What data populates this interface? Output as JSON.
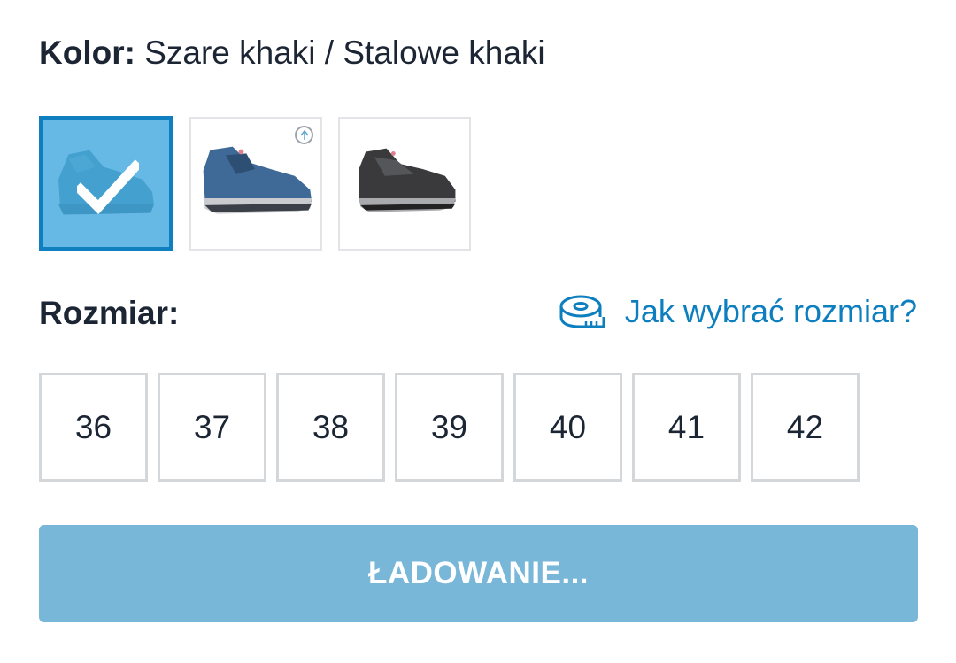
{
  "color": {
    "label": "Kolor:",
    "value": "Szare khaki / Stalowe khaki",
    "swatches": [
      {
        "name": "grey-khaki-shoe",
        "selected": true
      },
      {
        "name": "blue-shoe",
        "selected": false,
        "badge": "eco-icon"
      },
      {
        "name": "black-shoe",
        "selected": false
      }
    ]
  },
  "size": {
    "label": "Rozmiar:",
    "guide_label": "Jak wybrać rozmiar?",
    "guide_icon": "measuring-tape-icon",
    "options": [
      "36",
      "37",
      "38",
      "39",
      "40",
      "41",
      "42"
    ]
  },
  "button": {
    "label": "ŁADOWANIE..."
  },
  "colors": {
    "accent": "#0f7fc0",
    "link": "#0e7fbe",
    "button_disabled": "#79b7d9",
    "text": "#1b2533"
  }
}
